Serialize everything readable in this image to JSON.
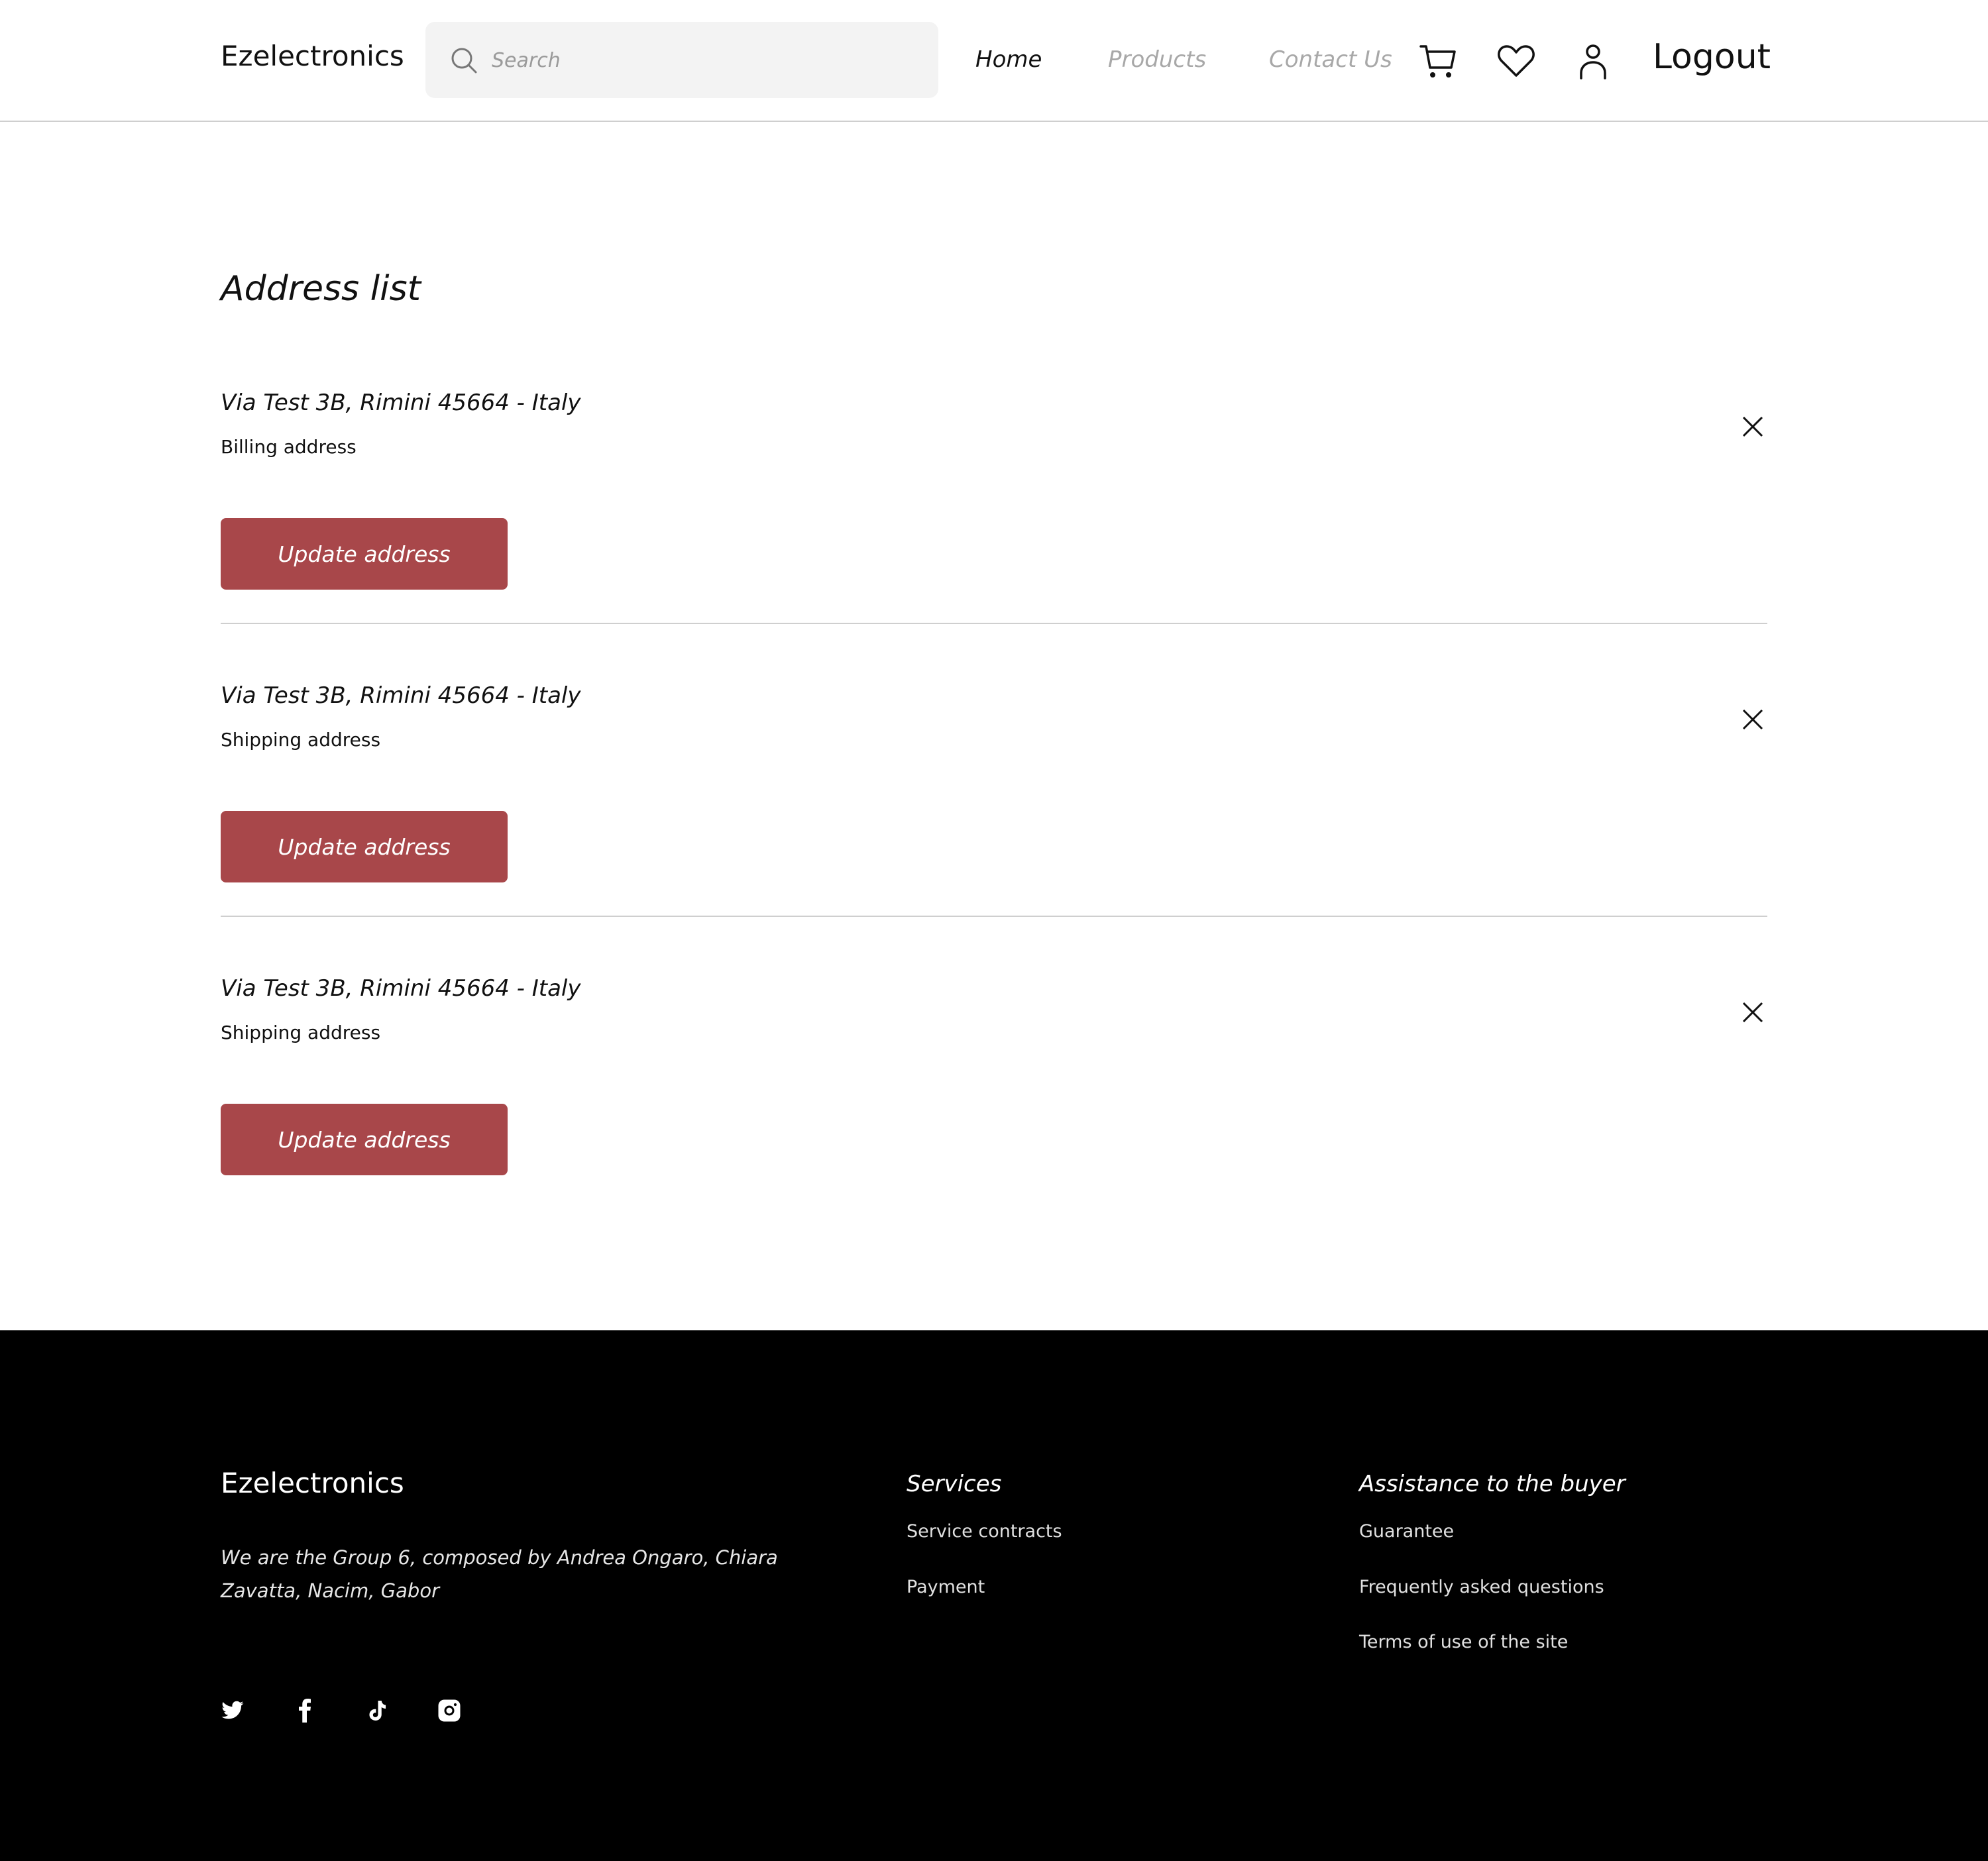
{
  "header": {
    "logo": "Ezelectronics",
    "search_placeholder": "Search",
    "nav": {
      "home": "Home",
      "products": "Products",
      "contact": "Contact Us"
    },
    "icons": [
      "cart-icon",
      "heart-icon",
      "user-icon"
    ],
    "logout": "Logout"
  },
  "main": {
    "title": "Address list",
    "addresses": [
      {
        "street": "Via Test 3B, Rimini 45664 - Italy",
        "type": "Billing address",
        "button": "Update address"
      },
      {
        "street": "Via Test 3B, Rimini 45664 - Italy",
        "type": "Shipping address",
        "button": "Update address"
      },
      {
        "street": "Via Test 3B, Rimini 45664 - Italy",
        "type": "Shipping address",
        "button": "Update address"
      }
    ]
  },
  "footer": {
    "logo": "Ezelectronics",
    "description": "We are the Group 6, composed by Andrea Ongaro, Chiara Zavatta, Nacim, Gabor",
    "social_icons": [
      "twitter-icon",
      "facebook-icon",
      "tiktok-icon",
      "instagram-icon"
    ],
    "services": {
      "title": "Services",
      "links": [
        "Service contracts",
        "Payment"
      ]
    },
    "assistance": {
      "title": "Assistance to the buyer",
      "links": [
        "Guarantee",
        "Frequently asked questions",
        "Terms of use of the site"
      ]
    }
  },
  "colors": {
    "accent": "#a8474a",
    "footer_bg": "#000000",
    "muted_nav": "#a8a8a8"
  }
}
